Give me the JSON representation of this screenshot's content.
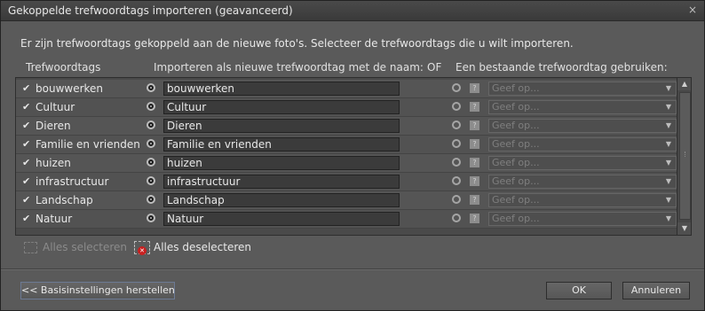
{
  "dialog": {
    "title": "Gekoppelde trefwoordtags importeren (geavanceerd)",
    "close_glyph": "×"
  },
  "intro": "Er zijn trefwoordtags gekoppeld aan de nieuwe foto's. Selecteer de trefwoordtags die u wilt importeren.",
  "columns": {
    "tags": "Trefwoordtags",
    "import_as": "Importeren als nieuwe trefwoordtag met de naam:",
    "or": "OF",
    "existing": "Een bestaande trefwoordtag gebruiken:"
  },
  "checkbox_glyph": "✔",
  "help_glyph": "?",
  "combo_placeholder": "Geef op...",
  "combo_arrow": "▼",
  "rows": [
    {
      "name": "bouwwerken",
      "import_name": "bouwwerken"
    },
    {
      "name": "Cultuur",
      "import_name": "Cultuur"
    },
    {
      "name": "Dieren",
      "import_name": "Dieren"
    },
    {
      "name": "Familie en vrienden",
      "import_name": "Familie en vrienden"
    },
    {
      "name": "huizen",
      "import_name": "huizen"
    },
    {
      "name": "infrastructuur",
      "import_name": "infrastructuur"
    },
    {
      "name": "Landschap",
      "import_name": "Landschap"
    },
    {
      "name": "Natuur",
      "import_name": "Natuur"
    }
  ],
  "scrollbar": {
    "up": "▲",
    "down": "▼"
  },
  "select_all": "Alles selecteren",
  "deselect_all": "Alles deselecteren",
  "deselect_glyph": "✕",
  "buttons": {
    "reset": "<< Basisinstellingen herstellen",
    "ok": "OK",
    "cancel": "Annuleren"
  },
  "colors": {
    "dialog_bg": "#5a5a5a",
    "accent_outline": "#6c7a94",
    "deselect_icon": "#c92020"
  }
}
